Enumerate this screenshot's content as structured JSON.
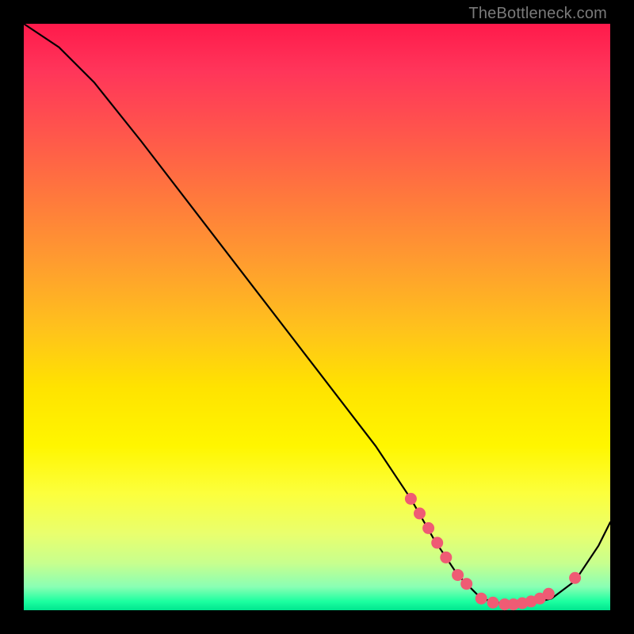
{
  "watermark": "TheBottleneck.com",
  "chart_data": {
    "type": "line",
    "title": "",
    "xlabel": "",
    "ylabel": "",
    "xlim": [
      0,
      100
    ],
    "ylim": [
      0,
      100
    ],
    "grid": false,
    "series": [
      {
        "name": "curve",
        "x": [
          0,
          6,
          12,
          20,
          30,
          40,
          50,
          60,
          66,
          70,
          74,
          78,
          82,
          86,
          90,
          94,
          98,
          100
        ],
        "y": [
          100,
          96,
          90,
          80,
          67,
          54,
          41,
          28,
          19,
          12,
          6,
          2,
          1,
          1,
          2,
          5,
          11,
          15
        ]
      }
    ],
    "markers": [
      {
        "x": 66.0,
        "y": 19.0
      },
      {
        "x": 67.5,
        "y": 16.5
      },
      {
        "x": 69.0,
        "y": 14.0
      },
      {
        "x": 70.5,
        "y": 11.5
      },
      {
        "x": 72.0,
        "y": 9.0
      },
      {
        "x": 74.0,
        "y": 6.0
      },
      {
        "x": 75.5,
        "y": 4.5
      },
      {
        "x": 78.0,
        "y": 2.0
      },
      {
        "x": 80.0,
        "y": 1.3
      },
      {
        "x": 82.0,
        "y": 1.0
      },
      {
        "x": 83.5,
        "y": 1.0
      },
      {
        "x": 85.0,
        "y": 1.2
      },
      {
        "x": 86.5,
        "y": 1.5
      },
      {
        "x": 88.0,
        "y": 2.0
      },
      {
        "x": 89.5,
        "y": 2.8
      },
      {
        "x": 94.0,
        "y": 5.5
      }
    ],
    "style": {
      "line_color": "#000000",
      "line_width": 2.2,
      "marker_fill": "#ef5b74",
      "marker_stroke": "#ef5b74",
      "marker_radius": 7
    }
  }
}
